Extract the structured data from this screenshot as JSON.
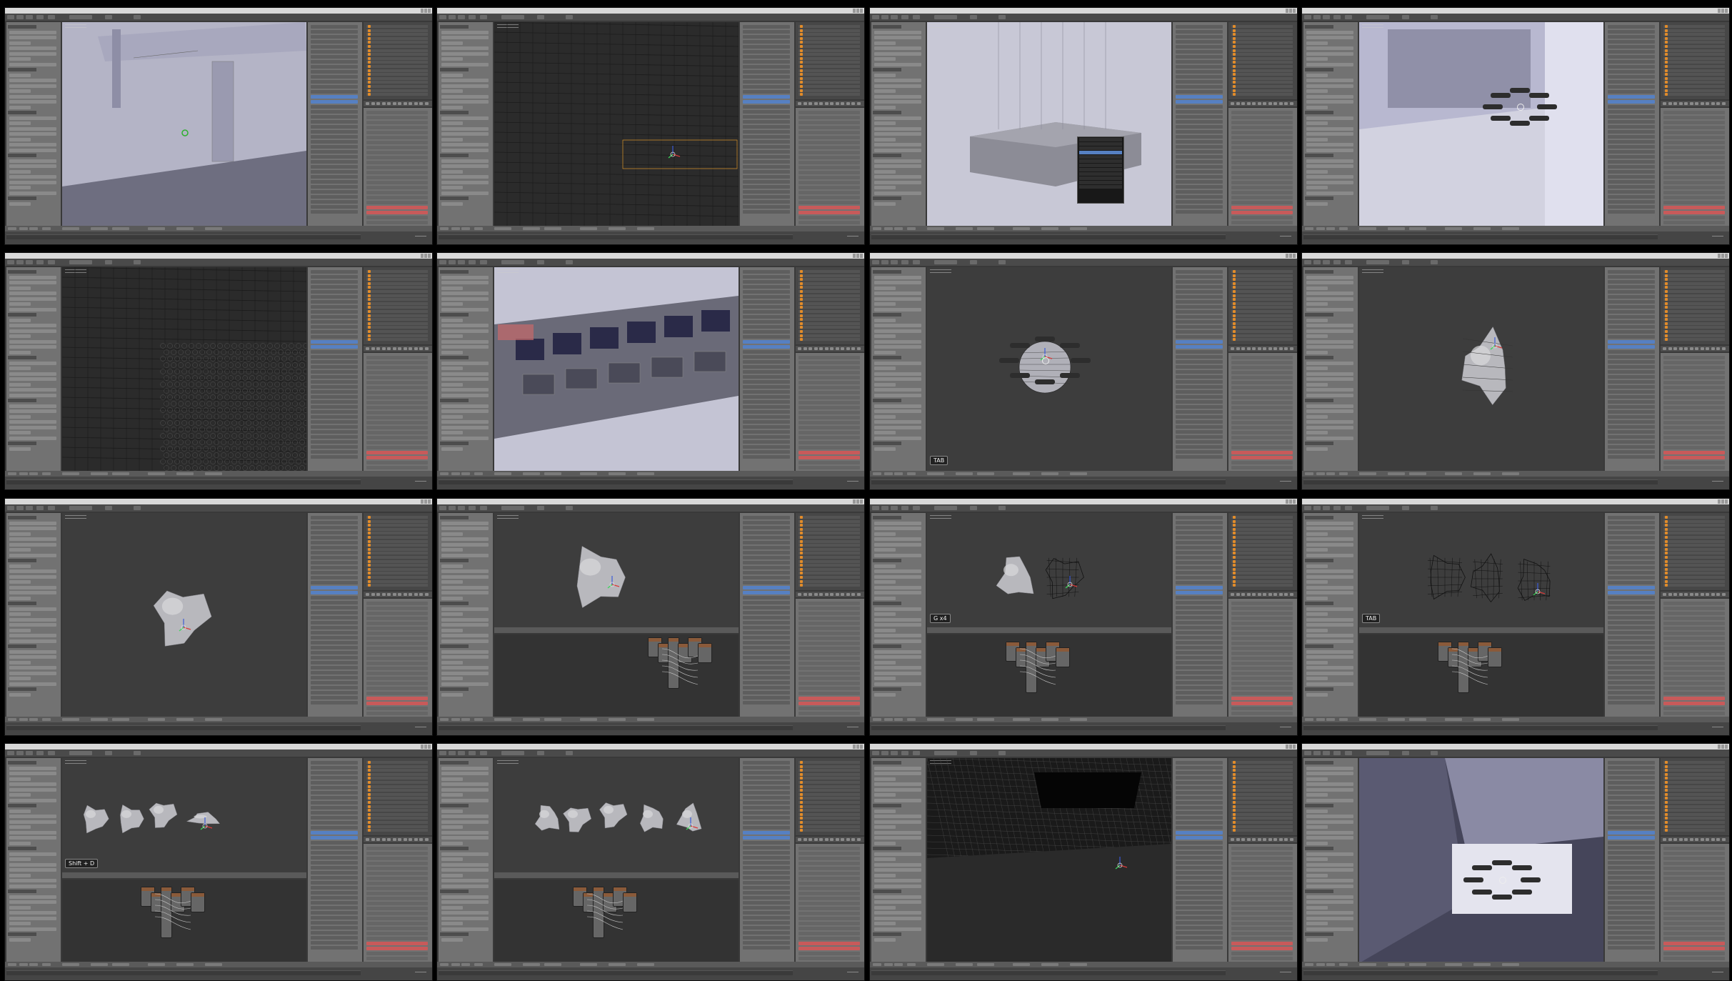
{
  "grid_title": "",
  "colors": {
    "panel_bg": "#727272",
    "viewport_bg": "#3d3d3d",
    "ui_blue": "#5680c2",
    "outliner_icon": "#e28c2a",
    "watermark": "#9a9a9a"
  },
  "tiles": [
    {
      "id": 1,
      "scene": "interior-wall-window",
      "keycast": "",
      "watermark": ""
    },
    {
      "id": 2,
      "scene": "dark-wireframe-wall",
      "keycast": "",
      "watermark": ""
    },
    {
      "id": 3,
      "scene": "box-with-context-menu",
      "keycast": "",
      "watermark": ""
    },
    {
      "id": 4,
      "scene": "interior-window-pie-menu",
      "keycast": "",
      "watermark": ""
    },
    {
      "id": 5,
      "scene": "hex-pattern-wall",
      "keycast": "",
      "watermark": ""
    },
    {
      "id": 6,
      "scene": "building-facade",
      "keycast": "",
      "watermark": ""
    },
    {
      "id": 7,
      "scene": "sphere-pie-menu",
      "keycast": "TAB",
      "watermark": ""
    },
    {
      "id": 8,
      "scene": "low-poly-rock",
      "keycast": "",
      "watermark": ""
    },
    {
      "id": 9,
      "scene": "smooth-rock",
      "keycast": "",
      "watermark": ""
    },
    {
      "id": 10,
      "scene": "rock-node-editor",
      "keycast": "",
      "watermark": ""
    },
    {
      "id": 11,
      "scene": "two-rocks-nodes",
      "keycast": "G x4",
      "watermark": ""
    },
    {
      "id": 12,
      "scene": "three-wire-rocks-nodes",
      "keycast": "TAB",
      "watermark": ""
    },
    {
      "id": 13,
      "scene": "four-rocks-nodes",
      "keycast": "Shift + D",
      "watermark": ""
    },
    {
      "id": 14,
      "scene": "five-rocks-nodes",
      "keycast": "",
      "watermark": ""
    },
    {
      "id": 15,
      "scene": "wireframe-building-top",
      "keycast": "",
      "watermark": ""
    },
    {
      "id": 16,
      "scene": "room-pie-menu",
      "keycast": "",
      "watermark": ""
    }
  ]
}
